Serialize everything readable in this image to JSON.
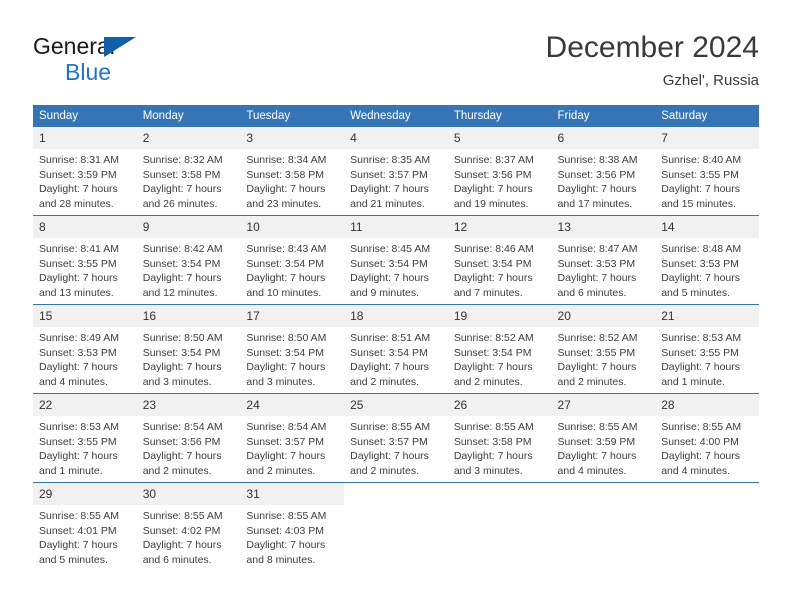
{
  "brand": {
    "name_top": "General",
    "name_bottom": "Blue",
    "flag_color": "#1060a8",
    "text_color": "#1f76c4"
  },
  "header": {
    "title": "December 2024",
    "location": "Gzhel', Russia"
  },
  "theme": {
    "header_bg": "#3575b6",
    "header_text": "#ffffff",
    "daynum_bg": "#f1f1f1",
    "rule_color": "#3575b6"
  },
  "calendar": {
    "weekday_headers": [
      "Sunday",
      "Monday",
      "Tuesday",
      "Wednesday",
      "Thursday",
      "Friday",
      "Saturday"
    ],
    "weeks": [
      [
        {
          "day": "1",
          "sunrise": "Sunrise: 8:31 AM",
          "sunset": "Sunset: 3:59 PM",
          "daylight_line1": "Daylight: 7 hours",
          "daylight_line2": "and 28 minutes."
        },
        {
          "day": "2",
          "sunrise": "Sunrise: 8:32 AM",
          "sunset": "Sunset: 3:58 PM",
          "daylight_line1": "Daylight: 7 hours",
          "daylight_line2": "and 26 minutes."
        },
        {
          "day": "3",
          "sunrise": "Sunrise: 8:34 AM",
          "sunset": "Sunset: 3:58 PM",
          "daylight_line1": "Daylight: 7 hours",
          "daylight_line2": "and 23 minutes."
        },
        {
          "day": "4",
          "sunrise": "Sunrise: 8:35 AM",
          "sunset": "Sunset: 3:57 PM",
          "daylight_line1": "Daylight: 7 hours",
          "daylight_line2": "and 21 minutes."
        },
        {
          "day": "5",
          "sunrise": "Sunrise: 8:37 AM",
          "sunset": "Sunset: 3:56 PM",
          "daylight_line1": "Daylight: 7 hours",
          "daylight_line2": "and 19 minutes."
        },
        {
          "day": "6",
          "sunrise": "Sunrise: 8:38 AM",
          "sunset": "Sunset: 3:56 PM",
          "daylight_line1": "Daylight: 7 hours",
          "daylight_line2": "and 17 minutes."
        },
        {
          "day": "7",
          "sunrise": "Sunrise: 8:40 AM",
          "sunset": "Sunset: 3:55 PM",
          "daylight_line1": "Daylight: 7 hours",
          "daylight_line2": "and 15 minutes."
        }
      ],
      [
        {
          "day": "8",
          "sunrise": "Sunrise: 8:41 AM",
          "sunset": "Sunset: 3:55 PM",
          "daylight_line1": "Daylight: 7 hours",
          "daylight_line2": "and 13 minutes."
        },
        {
          "day": "9",
          "sunrise": "Sunrise: 8:42 AM",
          "sunset": "Sunset: 3:54 PM",
          "daylight_line1": "Daylight: 7 hours",
          "daylight_line2": "and 12 minutes."
        },
        {
          "day": "10",
          "sunrise": "Sunrise: 8:43 AM",
          "sunset": "Sunset: 3:54 PM",
          "daylight_line1": "Daylight: 7 hours",
          "daylight_line2": "and 10 minutes."
        },
        {
          "day": "11",
          "sunrise": "Sunrise: 8:45 AM",
          "sunset": "Sunset: 3:54 PM",
          "daylight_line1": "Daylight: 7 hours",
          "daylight_line2": "and 9 minutes."
        },
        {
          "day": "12",
          "sunrise": "Sunrise: 8:46 AM",
          "sunset": "Sunset: 3:54 PM",
          "daylight_line1": "Daylight: 7 hours",
          "daylight_line2": "and 7 minutes."
        },
        {
          "day": "13",
          "sunrise": "Sunrise: 8:47 AM",
          "sunset": "Sunset: 3:53 PM",
          "daylight_line1": "Daylight: 7 hours",
          "daylight_line2": "and 6 minutes."
        },
        {
          "day": "14",
          "sunrise": "Sunrise: 8:48 AM",
          "sunset": "Sunset: 3:53 PM",
          "daylight_line1": "Daylight: 7 hours",
          "daylight_line2": "and 5 minutes."
        }
      ],
      [
        {
          "day": "15",
          "sunrise": "Sunrise: 8:49 AM",
          "sunset": "Sunset: 3:53 PM",
          "daylight_line1": "Daylight: 7 hours",
          "daylight_line2": "and 4 minutes."
        },
        {
          "day": "16",
          "sunrise": "Sunrise: 8:50 AM",
          "sunset": "Sunset: 3:54 PM",
          "daylight_line1": "Daylight: 7 hours",
          "daylight_line2": "and 3 minutes."
        },
        {
          "day": "17",
          "sunrise": "Sunrise: 8:50 AM",
          "sunset": "Sunset: 3:54 PM",
          "daylight_line1": "Daylight: 7 hours",
          "daylight_line2": "and 3 minutes."
        },
        {
          "day": "18",
          "sunrise": "Sunrise: 8:51 AM",
          "sunset": "Sunset: 3:54 PM",
          "daylight_line1": "Daylight: 7 hours",
          "daylight_line2": "and 2 minutes."
        },
        {
          "day": "19",
          "sunrise": "Sunrise: 8:52 AM",
          "sunset": "Sunset: 3:54 PM",
          "daylight_line1": "Daylight: 7 hours",
          "daylight_line2": "and 2 minutes."
        },
        {
          "day": "20",
          "sunrise": "Sunrise: 8:52 AM",
          "sunset": "Sunset: 3:55 PM",
          "daylight_line1": "Daylight: 7 hours",
          "daylight_line2": "and 2 minutes."
        },
        {
          "day": "21",
          "sunrise": "Sunrise: 8:53 AM",
          "sunset": "Sunset: 3:55 PM",
          "daylight_line1": "Daylight: 7 hours",
          "daylight_line2": "and 1 minute."
        }
      ],
      [
        {
          "day": "22",
          "sunrise": "Sunrise: 8:53 AM",
          "sunset": "Sunset: 3:55 PM",
          "daylight_line1": "Daylight: 7 hours",
          "daylight_line2": "and 1 minute."
        },
        {
          "day": "23",
          "sunrise": "Sunrise: 8:54 AM",
          "sunset": "Sunset: 3:56 PM",
          "daylight_line1": "Daylight: 7 hours",
          "daylight_line2": "and 2 minutes."
        },
        {
          "day": "24",
          "sunrise": "Sunrise: 8:54 AM",
          "sunset": "Sunset: 3:57 PM",
          "daylight_line1": "Daylight: 7 hours",
          "daylight_line2": "and 2 minutes."
        },
        {
          "day": "25",
          "sunrise": "Sunrise: 8:55 AM",
          "sunset": "Sunset: 3:57 PM",
          "daylight_line1": "Daylight: 7 hours",
          "daylight_line2": "and 2 minutes."
        },
        {
          "day": "26",
          "sunrise": "Sunrise: 8:55 AM",
          "sunset": "Sunset: 3:58 PM",
          "daylight_line1": "Daylight: 7 hours",
          "daylight_line2": "and 3 minutes."
        },
        {
          "day": "27",
          "sunrise": "Sunrise: 8:55 AM",
          "sunset": "Sunset: 3:59 PM",
          "daylight_line1": "Daylight: 7 hours",
          "daylight_line2": "and 4 minutes."
        },
        {
          "day": "28",
          "sunrise": "Sunrise: 8:55 AM",
          "sunset": "Sunset: 4:00 PM",
          "daylight_line1": "Daylight: 7 hours",
          "daylight_line2": "and 4 minutes."
        }
      ],
      [
        {
          "day": "29",
          "sunrise": "Sunrise: 8:55 AM",
          "sunset": "Sunset: 4:01 PM",
          "daylight_line1": "Daylight: 7 hours",
          "daylight_line2": "and 5 minutes."
        },
        {
          "day": "30",
          "sunrise": "Sunrise: 8:55 AM",
          "sunset": "Sunset: 4:02 PM",
          "daylight_line1": "Daylight: 7 hours",
          "daylight_line2": "and 6 minutes."
        },
        {
          "day": "31",
          "sunrise": "Sunrise: 8:55 AM",
          "sunset": "Sunset: 4:03 PM",
          "daylight_line1": "Daylight: 7 hours",
          "daylight_line2": "and 8 minutes."
        },
        {
          "day": "",
          "sunrise": "",
          "sunset": "",
          "daylight_line1": "",
          "daylight_line2": ""
        },
        {
          "day": "",
          "sunrise": "",
          "sunset": "",
          "daylight_line1": "",
          "daylight_line2": ""
        },
        {
          "day": "",
          "sunrise": "",
          "sunset": "",
          "daylight_line1": "",
          "daylight_line2": ""
        },
        {
          "day": "",
          "sunrise": "",
          "sunset": "",
          "daylight_line1": "",
          "daylight_line2": ""
        }
      ]
    ]
  }
}
